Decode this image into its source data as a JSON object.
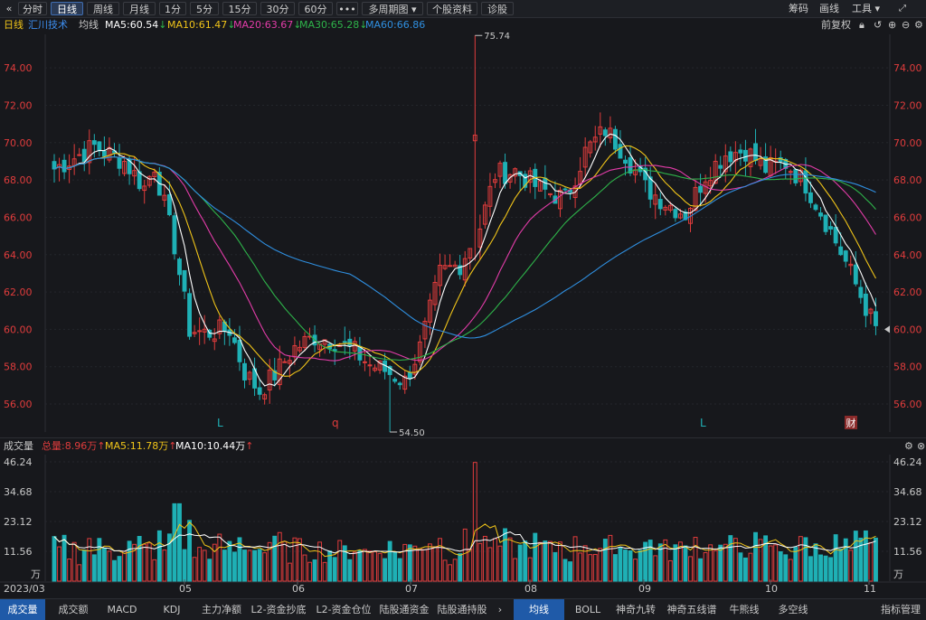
{
  "toolbar": {
    "back_icon": "double-chevron-left-icon",
    "periods": [
      "分时",
      "日线",
      "周线",
      "月线",
      "1分",
      "5分",
      "15分",
      "30分",
      "60分"
    ],
    "active_period": "日线",
    "more_label": "•••",
    "multi_period_label": "多周期图",
    "stock_info_label": "个股资料",
    "diagnose_label": "诊股",
    "right": {
      "chips": "筹码",
      "draw": "画线",
      "tools": "工具"
    }
  },
  "ma_bar": {
    "period": "日线",
    "stock_name": "汇川技术",
    "ma_label": "均线",
    "ma5": "MA5:60.54",
    "ma10": "MA10:61.47",
    "ma20": "MA20:63.67",
    "ma30": "MA30:65.28",
    "ma60": "MA60:66.86",
    "adjust": "前复权"
  },
  "colors": {
    "up": "#e03c3c",
    "down": "#1fb0b5",
    "ma5": "#ffffff",
    "ma10": "#f0c419",
    "ma20": "#e23ca8",
    "ma30": "#2eb34a",
    "ma60": "#2f8fe0",
    "axis": "#e03c3c"
  },
  "chart_data": [
    {
      "type": "candlestick",
      "y_ticks": [
        "74.00",
        "72.00",
        "70.00",
        "68.00",
        "66.00",
        "64.00",
        "62.00",
        "60.00",
        "58.00",
        "56.00"
      ],
      "ylim": [
        54.5,
        75.8
      ],
      "high_annotation": "75.74",
      "low_annotation": "54.50",
      "markers": [
        "L",
        "q",
        "L",
        "财"
      ],
      "last_price": 60.0
    },
    {
      "type": "bar",
      "title": "成交量",
      "total_label": "总量:8.96万",
      "ma5_label": "MA5:11.78万",
      "ma10_label": "MA10:10.44万",
      "y_ticks": [
        "46.24",
        "34.68",
        "23.12",
        "11.56"
      ],
      "unit": "万",
      "x_labels": [
        "2023/03",
        "05",
        "06",
        "07",
        "08",
        "09",
        "10",
        "11"
      ]
    }
  ],
  "bottom_tabs": {
    "left": [
      "成交量",
      "成交额",
      "MACD",
      "KDJ",
      "主力净额",
      "L2-资金抄底",
      "L2-资金仓位",
      "陆股通资金",
      "陆股通持股"
    ],
    "right": [
      "均线",
      "BOLL",
      "神奇九转",
      "神奇五线谱",
      "牛熊线",
      "多空线",
      "指标管理"
    ],
    "arrow": "›"
  }
}
